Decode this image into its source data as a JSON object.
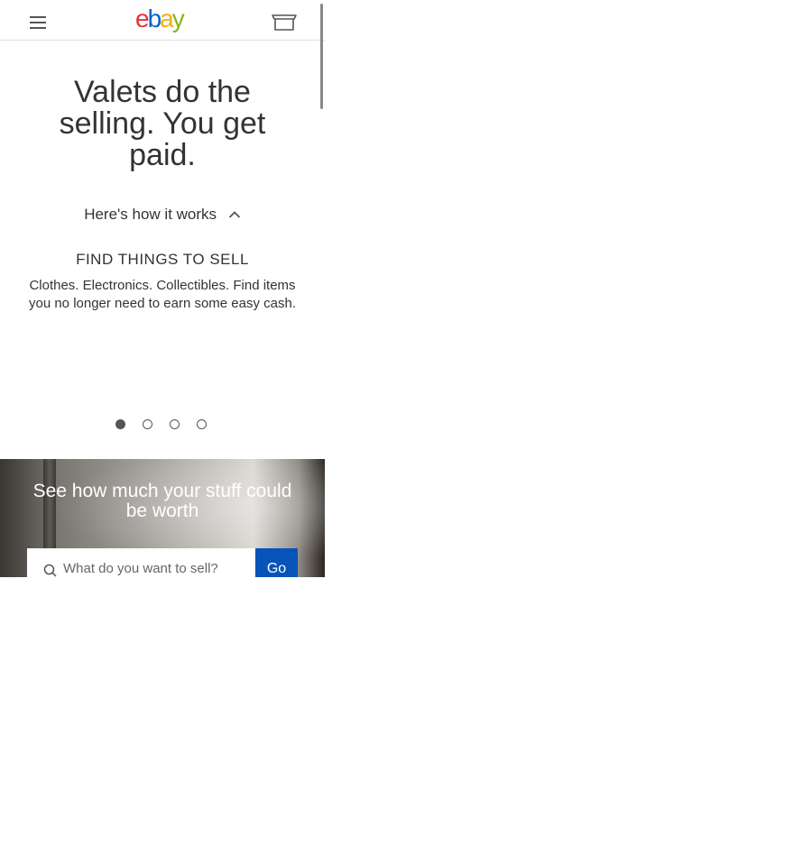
{
  "header": {
    "menu_icon": "hamburger-menu-icon",
    "logo": {
      "letters": [
        "e",
        "b",
        "a",
        "y"
      ],
      "colors": [
        "#e53238",
        "#0064d2",
        "#f5af02",
        "#86b817"
      ]
    },
    "cart_icon": "shopping-cart-icon"
  },
  "hero": {
    "title": "Valets do the selling. You get paid."
  },
  "how_it_works": {
    "label": "Here's how it works",
    "icon": "chevron-up-icon"
  },
  "carousel": {
    "step_title": "FIND THINGS TO SELL",
    "step_description": "Clothes. Electronics. Collectibles. Find items you no longer need to earn some easy cash.",
    "active_index": 0,
    "dot_count": 4
  },
  "banner": {
    "title": "See how much your stuff could be worth",
    "search": {
      "placeholder": "What do you want to sell?",
      "value": "",
      "icon": "search-icon"
    },
    "go_label": "Go"
  },
  "colors": {
    "text": "#333333",
    "accent_button": "#0654ba",
    "divider": "#dddddd"
  }
}
